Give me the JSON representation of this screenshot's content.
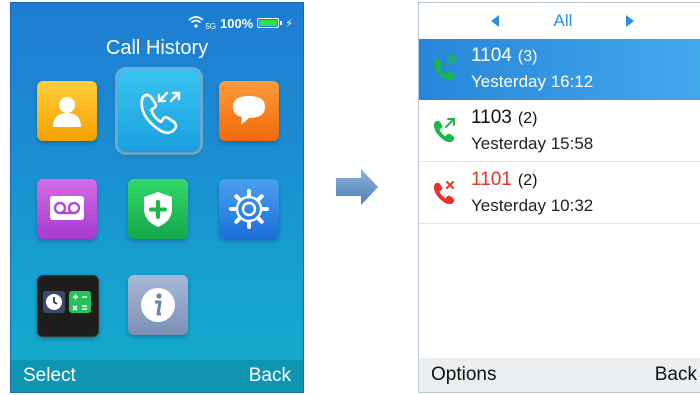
{
  "menu_screen": {
    "status": {
      "signal_label": "5G",
      "battery_percent": "100%",
      "battery_level": 1.0
    },
    "title": "Call History",
    "apps": [
      {
        "name": "contacts",
        "icon": "contacts-icon"
      },
      {
        "name": "call-history",
        "icon": "call-history-icon",
        "selected": true
      },
      {
        "name": "messages",
        "icon": "messages-icon"
      },
      {
        "name": "voicemail",
        "icon": "voicemail-icon"
      },
      {
        "name": "security",
        "icon": "shield-icon"
      },
      {
        "name": "settings",
        "icon": "settings-gear-icon"
      },
      {
        "name": "tools",
        "icon": "clock-calculator-icon"
      },
      {
        "name": "info",
        "icon": "info-icon"
      }
    ],
    "softkeys": {
      "left": "Select",
      "right": "Back"
    }
  },
  "history_screen": {
    "filter_tab": "All",
    "calls": [
      {
        "number": "1104",
        "count": "(3)",
        "time": "Yesterday 16:12",
        "type": "outgoing",
        "selected": true
      },
      {
        "number": "1103",
        "count": "(2)",
        "time": "Yesterday 15:58",
        "type": "outgoing"
      },
      {
        "number": "1101",
        "count": "(2)",
        "time": "Yesterday 10:32",
        "type": "missed"
      }
    ],
    "softkeys": {
      "left": "Options",
      "right": "Back"
    }
  },
  "colors": {
    "menu_bg": "#1b8ed2",
    "accent_blue": "#2b8ee0",
    "outgoing_green": "#19b84a",
    "missed_red": "#e8322a"
  }
}
